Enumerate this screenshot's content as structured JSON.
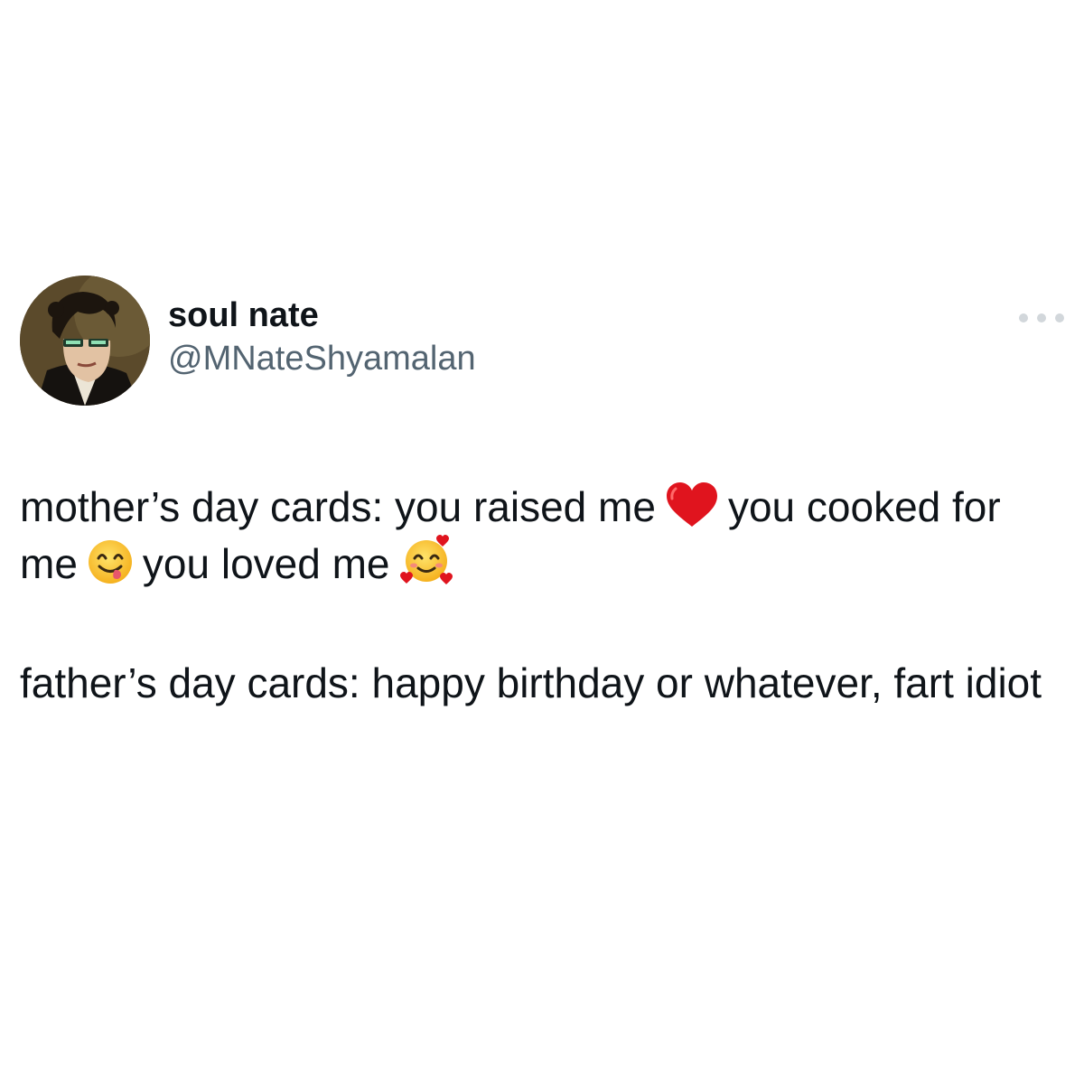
{
  "tweet": {
    "author": {
      "display_name": "soul nate",
      "handle": "@MNateShyamalan"
    },
    "body": {
      "para1": {
        "t1": "mother’s day cards: you raised me",
        "e1": "red-heart",
        "t2": "you cooked for me",
        "e2": "face-savoring-food",
        "t3": "you loved me",
        "e3": "smiling-face-with-hearts"
      },
      "para2": "father’s day cards: happy birthday or whatever, fart idiot"
    }
  },
  "colors": {
    "text": "#0f1419",
    "secondary_text": "#536471",
    "dots": "#d2d7db",
    "background": "#ffffff"
  },
  "icons": [
    "more-options-icon",
    "red-heart-emoji",
    "face-savoring-food-emoji",
    "smiling-face-with-hearts-emoji"
  ]
}
